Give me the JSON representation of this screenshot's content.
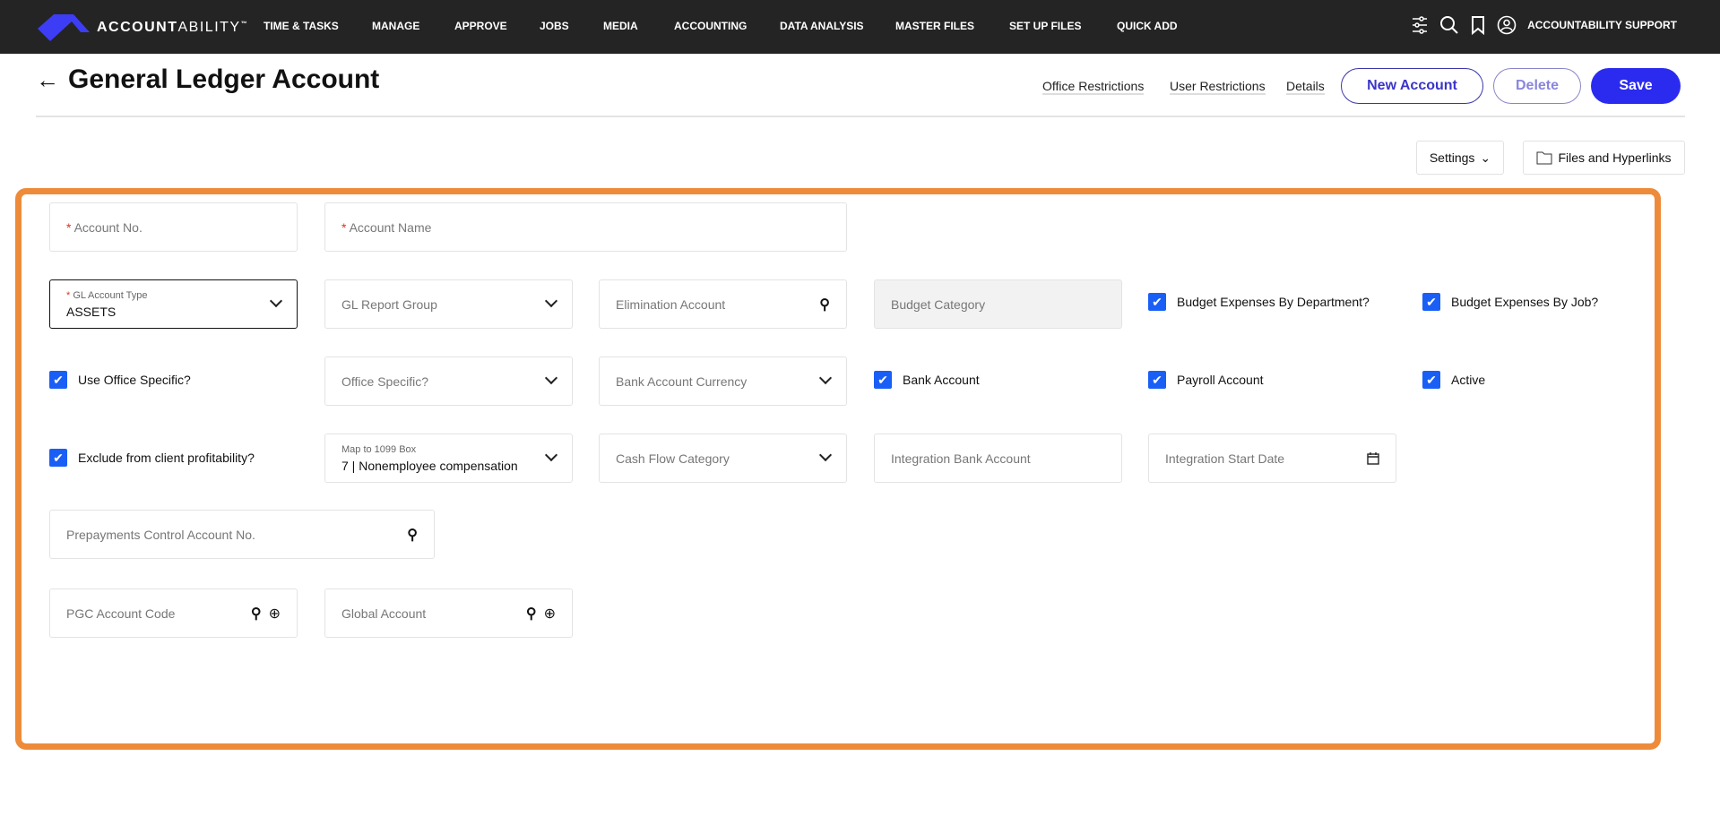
{
  "nav": {
    "brand": "ACCOUNTABILITY",
    "brand_bold": "ACCOUNT",
    "brand_thin": "ABILITY",
    "tm": "™",
    "items": [
      "TIME & TASKS",
      "MANAGE",
      "APPROVE",
      "JOBS",
      "MEDIA",
      "ACCOUNTING",
      "DATA ANALYSIS",
      "MASTER FILES",
      "SET UP FILES",
      "QUICK ADD"
    ],
    "user": "ACCOUNTABILITY SUPPORT"
  },
  "header": {
    "title": "General Ledger Account",
    "links": [
      "Office Restrictions",
      "User Restrictions",
      "Details"
    ],
    "new_account": "New Account",
    "delete": "Delete",
    "save": "Save"
  },
  "toolbar": {
    "settings": "Settings",
    "files": "Files and Hyperlinks"
  },
  "form": {
    "account_no": "Account No.",
    "account_name": "Account Name",
    "gl_account_type_label": "GL Account Type",
    "gl_account_type_value": "ASSETS",
    "gl_report_group": "GL Report Group",
    "elimination_account": "Elimination Account",
    "budget_category": "Budget Category",
    "budget_by_department": "Budget Expenses By Department?",
    "budget_by_job": "Budget Expenses By Job?",
    "use_office_specific": "Use Office Specific?",
    "office_specific": "Office Specific?",
    "bank_account_currency": "Bank Account Currency",
    "bank_account": "Bank Account",
    "payroll_account": "Payroll Account",
    "active": "Active",
    "exclude_profitability": "Exclude from client profitability?",
    "map_1099_label": "Map to 1099 Box",
    "map_1099_value": "7 | Nonemployee compensation",
    "cash_flow_category": "Cash Flow Category",
    "integration_bank_account": "Integration Bank Account",
    "integration_start_date": "Integration Start Date",
    "prepayments_control": "Prepayments Control Account No.",
    "pgc_account_code": "PGC Account Code",
    "global_account": "Global Account",
    "checked": {
      "budget_by_department": true,
      "budget_by_job": true,
      "use_office_specific": true,
      "bank_account": true,
      "payroll_account": true,
      "active": true,
      "exclude_profitability": true
    }
  },
  "colors": {
    "accent": "#2B2BF0",
    "highlight": "#EE8B3A",
    "checkbox": "#1A5FF5"
  }
}
